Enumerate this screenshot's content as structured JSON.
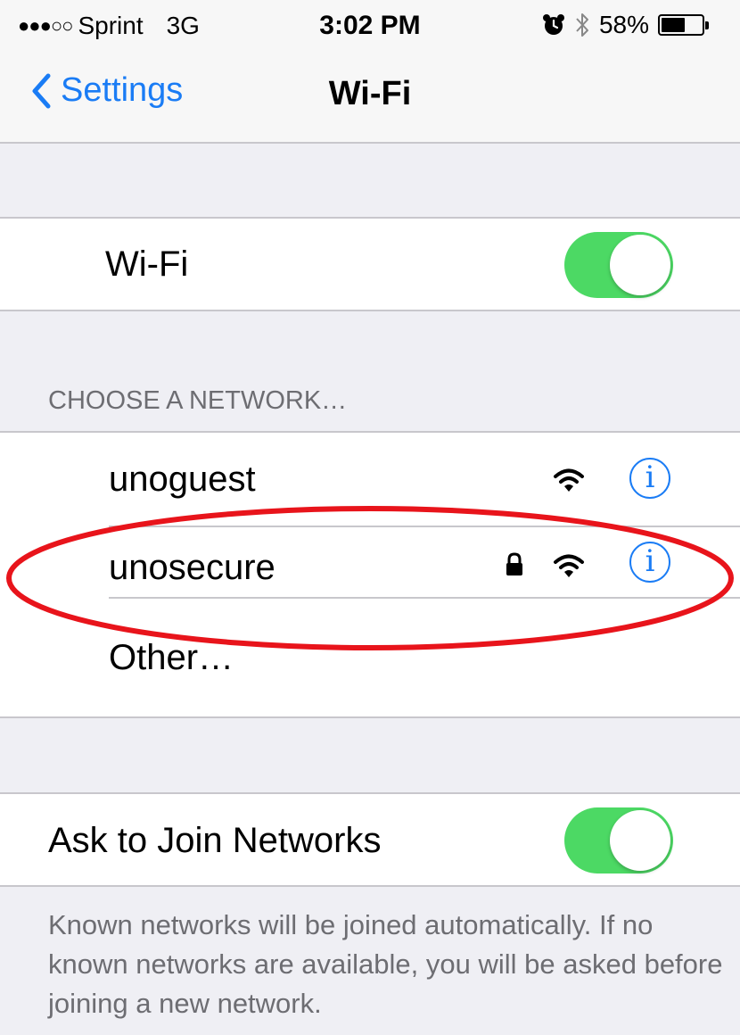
{
  "status_bar": {
    "signal_dots": "●●●○○",
    "carrier": "Sprint",
    "network_type": "3G",
    "time": "3:02 PM",
    "battery_percent": "58%",
    "battery_level": 0.58,
    "icons": [
      "alarm-icon",
      "bluetooth-icon",
      "battery-icon"
    ]
  },
  "nav": {
    "back_label": "Settings",
    "title": "Wi-Fi"
  },
  "wifi_toggle": {
    "label": "Wi-Fi",
    "on": true
  },
  "networks": {
    "header": "CHOOSE A NETWORK…",
    "items": [
      {
        "name": "unoguest",
        "secured": false,
        "info": "i"
      },
      {
        "name": "unosecure",
        "secured": true,
        "info": "i"
      }
    ],
    "other_label": "Other…"
  },
  "ask_to_join": {
    "label": "Ask to Join Networks",
    "on": true,
    "note": "Known networks will be joined automatically. If no known networks are available, you will be asked before joining a new network."
  },
  "colors": {
    "accent": "#1a7cf5",
    "toggle_on": "#4cd964",
    "highlight": "#e8141b"
  }
}
